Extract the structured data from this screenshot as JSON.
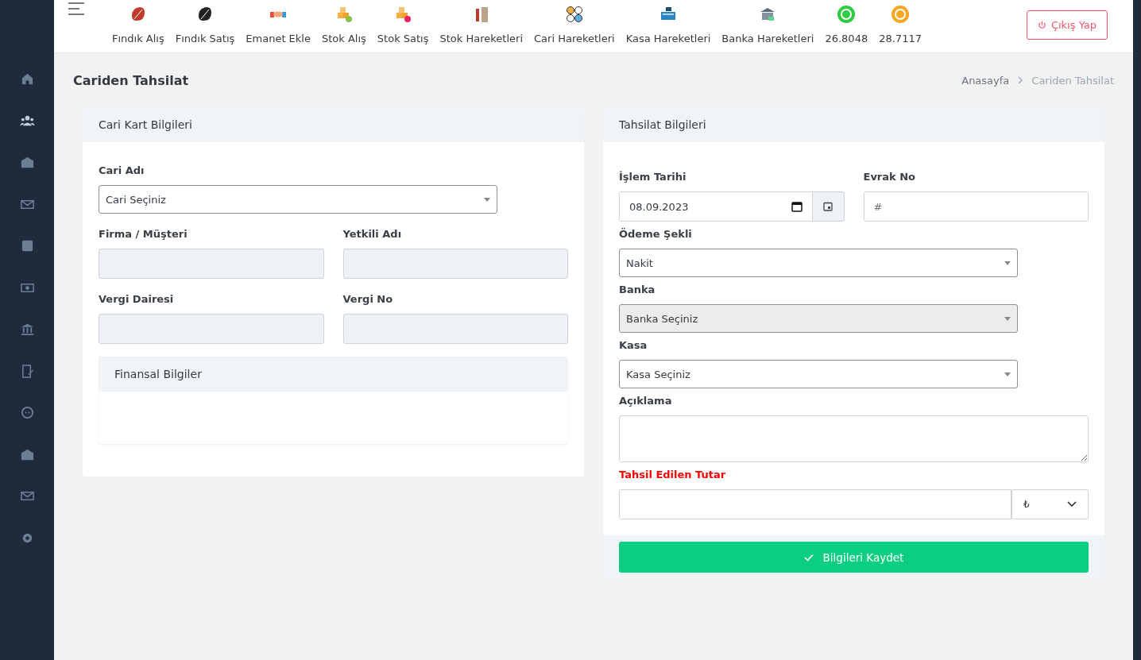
{
  "topbar": {
    "items": [
      {
        "label": "Fındık Alış"
      },
      {
        "label": "Fındık Satış"
      },
      {
        "label": "Emanet Ekle"
      },
      {
        "label": "Stok Alış"
      },
      {
        "label": "Stok Satış"
      },
      {
        "label": "Stok Hareketleri"
      },
      {
        "label": "Cari Hareketleri"
      },
      {
        "label": "Kasa Hareketleri"
      },
      {
        "label": "Banka Hareketleri"
      },
      {
        "label": "26.8048"
      },
      {
        "label": "28.7117"
      }
    ],
    "logout": "Çıkış Yap"
  },
  "sidebar": {
    "items": [
      {
        "selected": false
      },
      {
        "selected": true
      },
      {
        "selected": false
      },
      {
        "selected": false
      },
      {
        "selected": false
      },
      {
        "selected": false
      },
      {
        "selected": false
      },
      {
        "selected": false
      },
      {
        "selected": false
      },
      {
        "selected": false
      },
      {
        "selected": false
      },
      {
        "selected": false
      }
    ]
  },
  "page": {
    "title": "Cariden Tahsilat",
    "breadcrumb": [
      "Anasayfa",
      "Cariden Tahsilat"
    ]
  },
  "left_card": {
    "title": "Cari Kart Bilgileri",
    "cari": {
      "label": "Cari Adı",
      "value": "Cari Seçiniz"
    },
    "fields": [
      {
        "label": "Firma / Müşteri"
      },
      {
        "label": "Yetkili Adı"
      },
      {
        "label": "Vergi Dairesi"
      },
      {
        "label": "Vergi No"
      }
    ],
    "section": "Finansal Bilgiler"
  },
  "right_card": {
    "title": "Tahsilat Bilgileri",
    "fields": [
      {
        "kind": "date",
        "label": "İşlem Tarihi",
        "value": "08.09.2023"
      },
      {
        "kind": "text",
        "label": "Evrak No",
        "placeholder": "#"
      },
      {
        "kind": "select",
        "label": "Ödeme Şekli",
        "value": "Nakit",
        "disabled": false
      },
      {
        "kind": "select",
        "label": "Banka",
        "value": "Banka Seçiniz",
        "disabled": true
      },
      {
        "kind": "select",
        "label": "Kasa",
        "value": "Kasa Seçiniz",
        "disabled": false
      },
      {
        "kind": "textarea",
        "label": "Açıklama"
      },
      {
        "kind": "amount",
        "label": "Tahsil Edilen Tutar",
        "currency": "₺"
      }
    ],
    "submit": "Bilgileri Kaydet"
  }
}
